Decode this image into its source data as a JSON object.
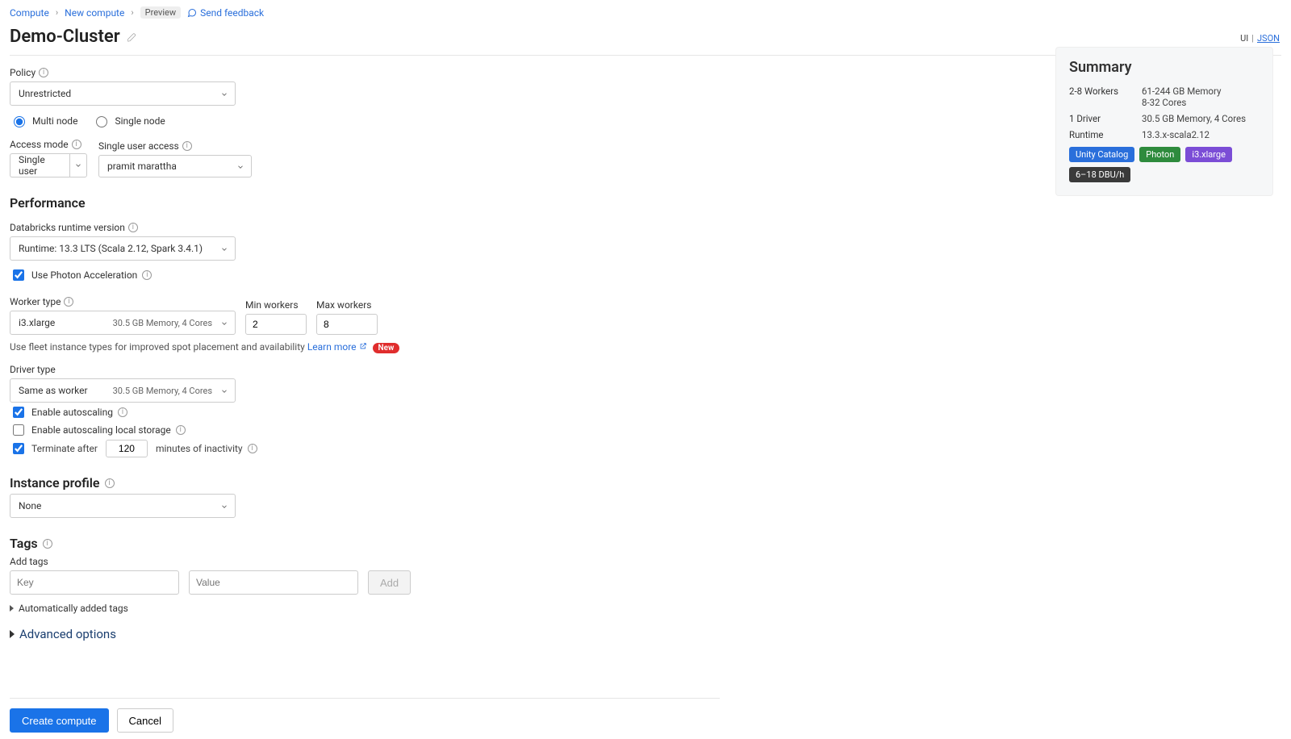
{
  "breadcrumb": {
    "a": "Compute",
    "b": "New compute",
    "preview": "Preview",
    "feedback": "Send feedback"
  },
  "title": "Demo-Cluster",
  "toggle": {
    "ui": "UI",
    "json": "JSON"
  },
  "policy": {
    "label": "Policy",
    "value": "Unrestricted"
  },
  "nodeMode": {
    "multi": "Multi node",
    "single": "Single node"
  },
  "access": {
    "label": "Access mode",
    "value": "Single user"
  },
  "userAccess": {
    "label": "Single user access",
    "value": "pramit marattha"
  },
  "perf": {
    "heading": "Performance",
    "runtimeLabel": "Databricks runtime version",
    "runtimeValue": "Runtime: 13.3 LTS (Scala 2.12, Spark 3.4.1)",
    "photon": "Use Photon Acceleration",
    "workerTypeLabel": "Worker type",
    "workerTypeValue": "i3.xlarge",
    "workerTypeDetail": "30.5 GB Memory, 4 Cores",
    "minLabel": "Min workers",
    "minVal": "2",
    "maxLabel": "Max workers",
    "maxVal": "8",
    "fleetHint": "Use fleet instance types for improved spot placement and availability",
    "learnMore": "Learn more",
    "new": "New",
    "driverLabel": "Driver type",
    "driverValue": "Same as worker",
    "driverDetail": "30.5 GB Memory, 4 Cores",
    "autoscale": "Enable autoscaling",
    "localStorage": "Enable autoscaling local storage",
    "terminatePre": "Terminate after",
    "terminateVal": "120",
    "terminatePost": "minutes of inactivity"
  },
  "instanceProfile": {
    "heading": "Instance profile",
    "value": "None"
  },
  "tags": {
    "heading": "Tags",
    "addLabel": "Add tags",
    "keyPh": "Key",
    "valPh": "Value",
    "addBtn": "Add",
    "auto": "Automatically added tags"
  },
  "advanced": "Advanced options",
  "footer": {
    "create": "Create compute",
    "cancel": "Cancel"
  },
  "summary": {
    "heading": "Summary",
    "workers_k": "2-8 Workers",
    "workers_v1": "61-244 GB Memory",
    "workers_v2": "8-32 Cores",
    "driver_k": "1 Driver",
    "driver_v": "30.5 GB Memory, 4 Cores",
    "runtime_k": "Runtime",
    "runtime_v": "13.3.x-scala2.12",
    "badge1": "Unity Catalog",
    "badge2": "Photon",
    "badge3": "i3.xlarge",
    "badge4": "6–18 DBU/h"
  }
}
